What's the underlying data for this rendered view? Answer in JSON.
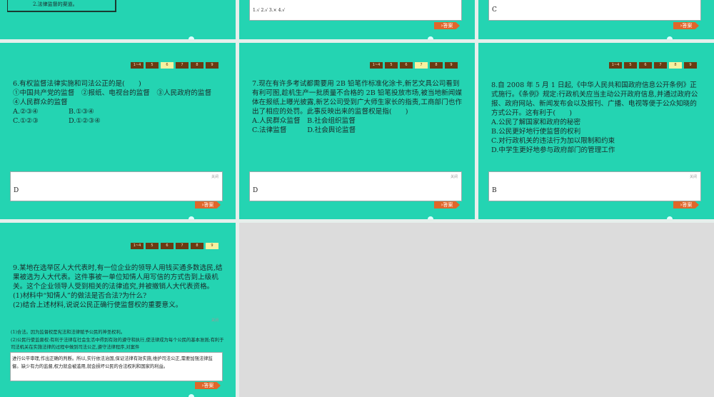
{
  "nav": [
    "1~4",
    "5",
    "6",
    "7",
    "8",
    "9"
  ],
  "answer_button": "›答案",
  "close_label": "关闭",
  "slides_top": {
    "s1_text": "2.法律监督的渠道。",
    "s2_answer": "1.√ 2.√ 3.× 4.√",
    "s3_answer": "C"
  },
  "q6": {
    "title": "6.有权监督法律实施和司法公正的是(　　)",
    "l1": "①中国共产党的监督　②报纸、电视台的监督　③人民政府的监督",
    "l2": "④人民群众的监督",
    "a": "A.②③④",
    "b": "B.①③④",
    "c": "C.①②③",
    "d": "D.①②③④",
    "answer": "D"
  },
  "q7": {
    "title": "7.现在有许多考试都需要用 2B 铅笔作标准化涂卡,新艺文具公司看到有利可图,趁机生产一批质量不合格的 2B 铅笔投放市场,被当地新闻媒体在报纸上曝光披露,新艺公司受到广大师生家长的指责,工商部门也作出了相应的处罚。此事反映出来的监督权是指(　　)",
    "ab": "A.人民群众监督　B.社会组织监督",
    "cd": "C.法律监督　　　D.社会舆论监督",
    "answer": "D"
  },
  "q8": {
    "title": "8.自 2008 年 5 月 1 日起,《中华人民共和国政府信息公开条例》正式施行。《条例》规定:行政机关应当主动公开政府信息,并通过政府公报、政府网站、新闻发布会以及报刊、广播、电视等便于公众知晓的方式公开。这有利于(　　)",
    "a": "A.公民了解国家和政府的秘密",
    "b": "B.公民更好地行使监督的权利",
    "c": "C.对行政机关的违法行为加以限制和约束",
    "d": "D.中学生更好地参与政府部门的管理工作",
    "answer": "B"
  },
  "q9": {
    "title": "9.某地在选举区人大代表时,有一位企业的领导人用钱买通多数选民,结果被选为人大代表。这件事被一单位知情人用写信的方式告到上级机关。这个企业领导人受到相关的法律追究,并被撤销人大代表资格。",
    "p1": "(1)材料中“知情人”的做法是否合法?为什么?",
    "p2": "(2)结合上述材料,说说公民正确行使监督权的重要意义。",
    "ans1": "(1)合法。因为监督权是宪法和法律赋予公民的神圣权利。",
    "ans2": "(2)公民行使监督权:有利于法律在社会生活中得到有效的遵守和执行,使法律成为每个公民的基本准则;有利于司法机关在实施法律的过程中做到司法公正,遵守法律程序,对案件",
    "ans3": "进行公平审理,作出正确的判断。所以,实行依法治国,保证法律有效实施,维护司法公正,需要加强法律监督。缺少有力的监督,权力就会被滥用,就会损坏公民的合法权利和国家的利益。"
  }
}
